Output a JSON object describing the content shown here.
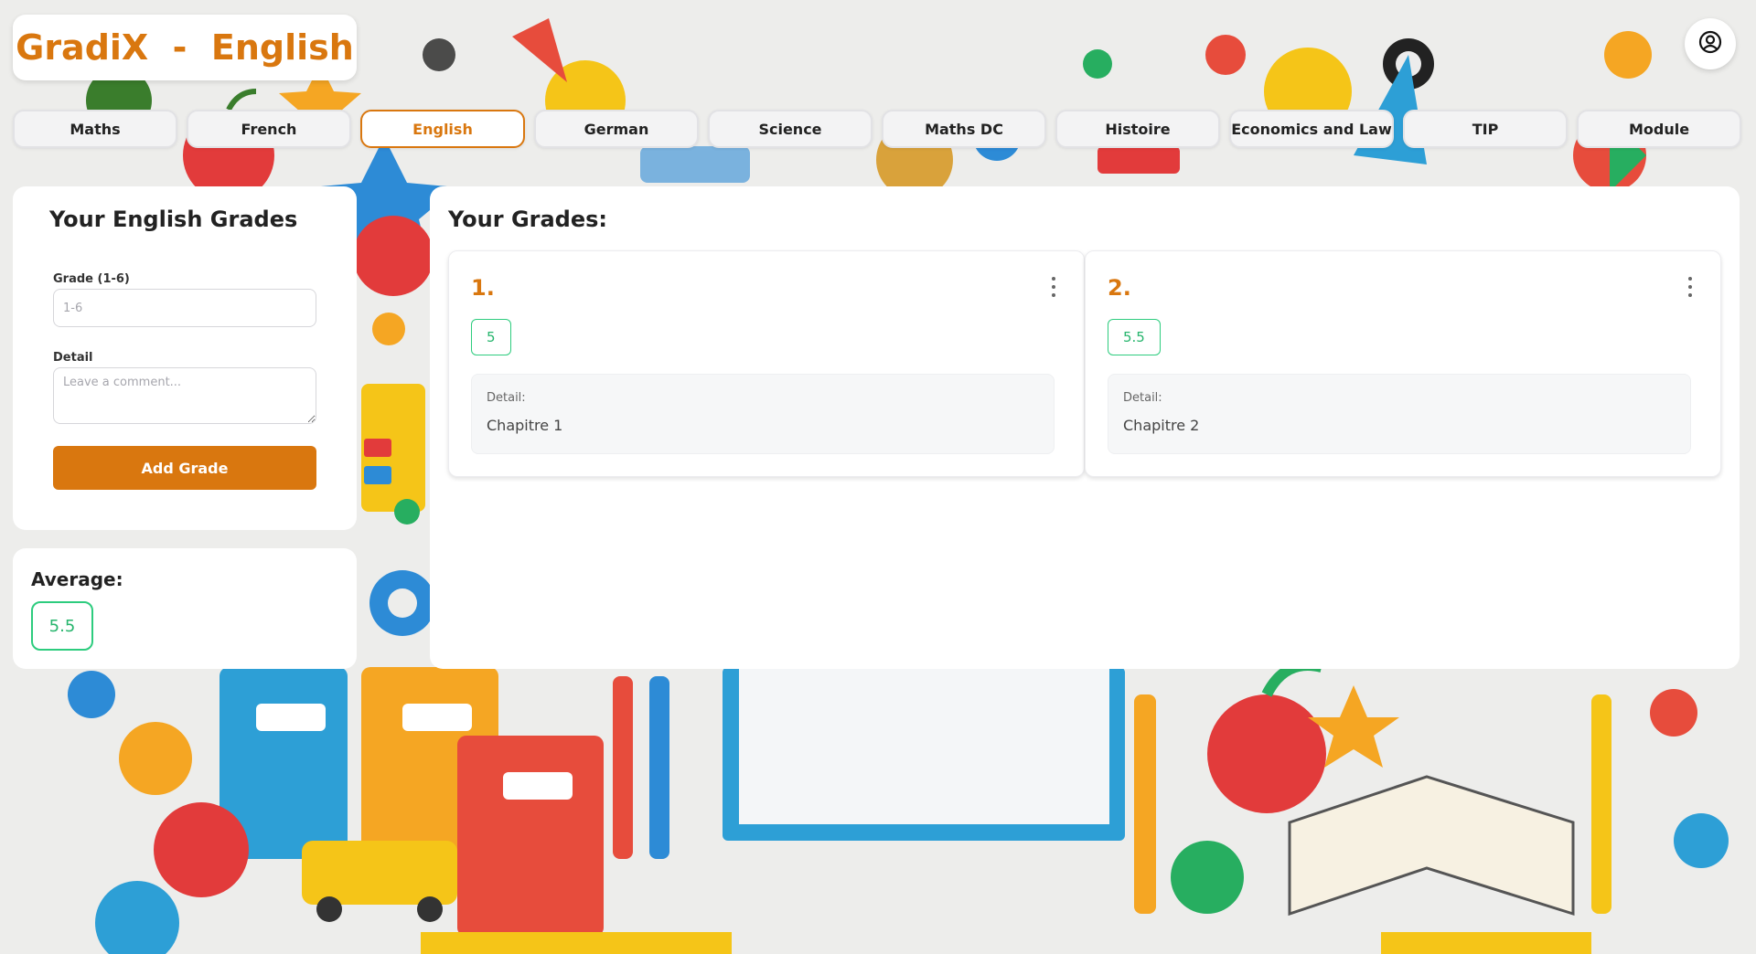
{
  "header": {
    "title": "GradiX  -  English",
    "profile_icon": "user-circle-icon"
  },
  "colors": {
    "accent": "#d9770f",
    "success": "#2dcc7e",
    "card_bg": "#ffffff"
  },
  "tabs": [
    {
      "label": "Maths",
      "active": false
    },
    {
      "label": "French",
      "active": false
    },
    {
      "label": "English",
      "active": true
    },
    {
      "label": "German",
      "active": false
    },
    {
      "label": "Science",
      "active": false
    },
    {
      "label": "Maths DC",
      "active": false
    },
    {
      "label": "Histoire",
      "active": false
    },
    {
      "label": "Economics and Law",
      "active": false
    },
    {
      "label": "TIP",
      "active": false
    },
    {
      "label": "Module",
      "active": false
    }
  ],
  "form": {
    "title": "Your English Grades",
    "grade_label": "Grade (1-6)",
    "grade_placeholder": "1-6",
    "grade_value": "",
    "detail_label": "Detail",
    "detail_placeholder": "Leave a comment...",
    "detail_value": "",
    "submit_label": "Add Grade"
  },
  "average": {
    "label": "Average:",
    "value": "5.5"
  },
  "grades_panel": {
    "title": "Your Grades:",
    "grades": [
      {
        "number": "1.",
        "value": "5",
        "detail_label": "Detail:",
        "detail": "Chapitre 1",
        "menu_icon": "more-vertical-icon"
      },
      {
        "number": "2.",
        "value": "5.5",
        "detail_label": "Detail:",
        "detail": "Chapitre 2",
        "menu_icon": "more-vertical-icon"
      }
    ]
  }
}
